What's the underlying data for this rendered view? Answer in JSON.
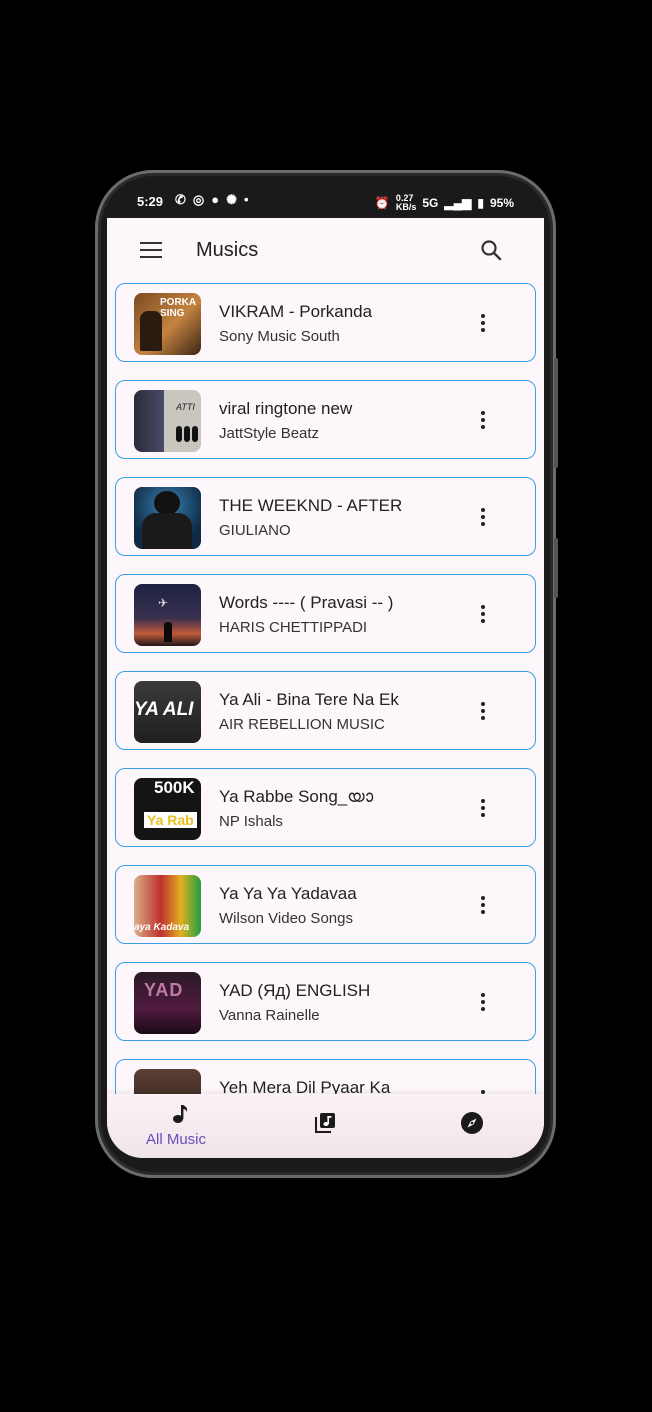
{
  "status_bar": {
    "time": "5:29",
    "network_speed": "0.27",
    "network_unit": "KB/s",
    "network_type": "5G",
    "battery": "95%"
  },
  "appbar": {
    "title": "Musics"
  },
  "songs": [
    {
      "title": "VIKRAM - Porkanda",
      "artist": "Sony Music South"
    },
    {
      "title": "viral ringtone new",
      "artist": "JattStyle Beatz"
    },
    {
      "title": "THE WEEKND - AFTER",
      "artist": "GIULIANO"
    },
    {
      "title": "Words ---- ( Pravasi -- )",
      "artist": "HARIS CHETTIPPADI"
    },
    {
      "title": "Ya Ali - Bina Tere Na Ek",
      "artist": "AIR REBELLION MUSIC"
    },
    {
      "title": "Ya Rabbe Song_യാ",
      "artist": "NP Ishals"
    },
    {
      "title": "Ya Ya Ya Yadavaa",
      "artist": "Wilson Video Songs"
    },
    {
      "title": "YAD (Яд) ENGLISH",
      "artist": "Vanna Rainelle"
    },
    {
      "title": "Yeh Mera Dil Pyaar Ka",
      "artist": ""
    }
  ],
  "thumb_text": {
    "t1": "PORKA SING",
    "t2": "ATTI",
    "t5": "YA ALI",
    "t6a": "500K",
    "t6b": "Ya Rab",
    "t7": "aya Kadava",
    "t8": "YAD"
  },
  "bottom_nav": {
    "items": [
      {
        "label": "All Music",
        "icon": "music-note-icon",
        "active": true
      },
      {
        "label": "",
        "icon": "playlist-icon",
        "active": false
      },
      {
        "label": "",
        "icon": "compass-icon",
        "active": false
      }
    ]
  },
  "colors": {
    "accent": "#6a4bbd",
    "card_border": "#3aa0e6",
    "background": "#fdf7fb"
  }
}
